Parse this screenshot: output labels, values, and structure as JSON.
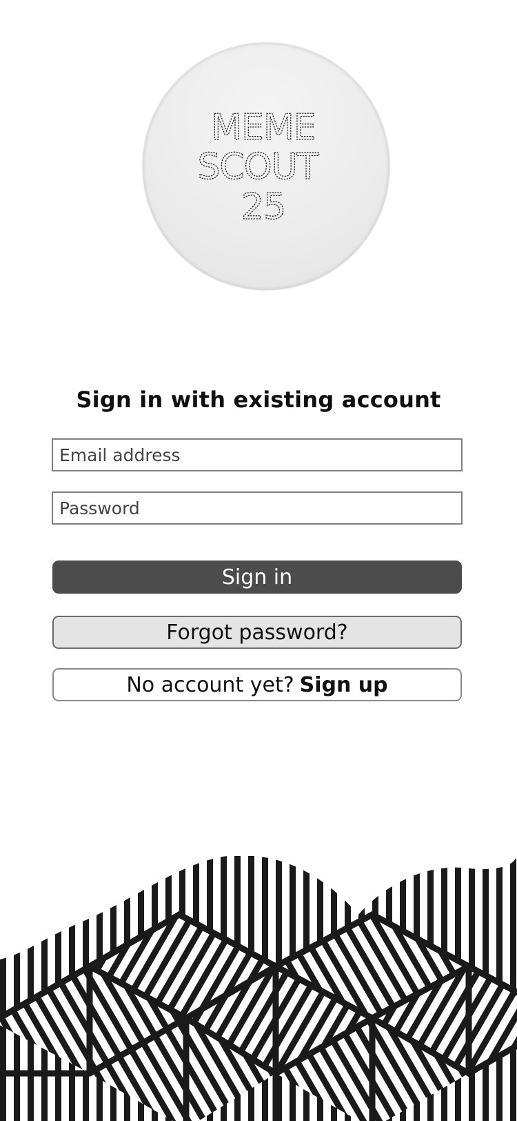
{
  "logo": {
    "lines": [
      "MEME",
      "SCOUT",
      "25"
    ]
  },
  "login": {
    "heading": "Sign in with existing account",
    "email_placeholder": "Email address",
    "password_placeholder": "Password",
    "signin_label": "Sign in",
    "forgot_label": "Forgot password?",
    "signup_prompt": "No account yet?",
    "signup_label": "Sign up"
  },
  "colors": {
    "background": "#ffffff",
    "primary_button": "#4c4c4c",
    "secondary_button": "#e4e4e4",
    "pattern_stroke": "#1a1a1a"
  },
  "decoration": {
    "pattern_name": "isometric-cube-stripe-pattern"
  }
}
